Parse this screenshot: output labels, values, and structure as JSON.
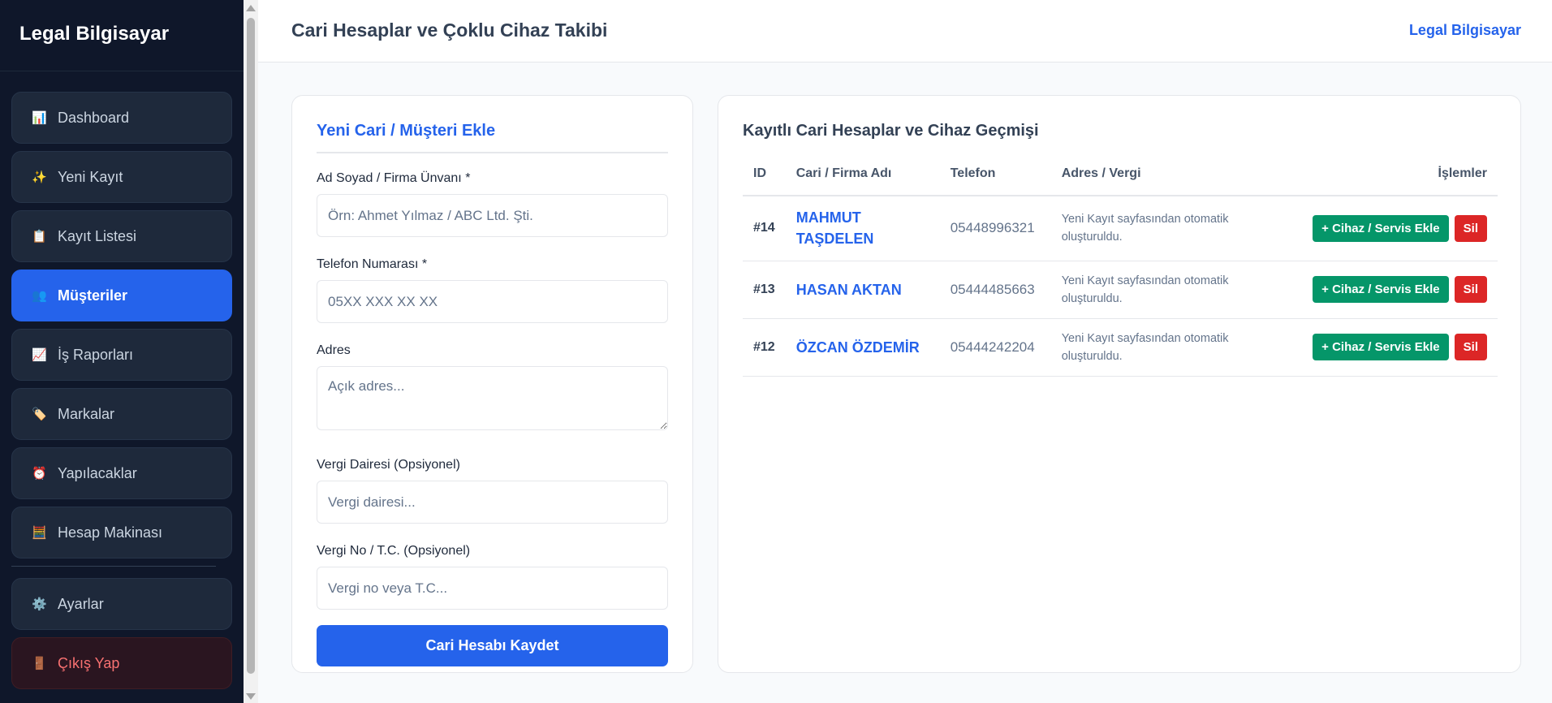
{
  "sidebar": {
    "brand": "Legal Bilgisayar",
    "items": [
      {
        "icon": "📊",
        "label": "Dashboard"
      },
      {
        "icon": "✨",
        "label": "Yeni Kayıt"
      },
      {
        "icon": "📋",
        "label": "Kayıt Listesi"
      },
      {
        "icon": "👥",
        "label": "Müşteriler"
      },
      {
        "icon": "📈",
        "label": "İş Raporları"
      },
      {
        "icon": "🏷️",
        "label": "Markalar"
      },
      {
        "icon": "⏰",
        "label": "Yapılacaklar"
      },
      {
        "icon": "🧮",
        "label": "Hesap Makinası"
      },
      {
        "icon": "⚙️",
        "label": "Ayarlar"
      },
      {
        "icon": "🚪",
        "label": "Çıkış Yap"
      }
    ],
    "active_index": 3
  },
  "header": {
    "title": "Cari Hesaplar ve Çoklu Cihaz Takibi",
    "link": "Legal Bilgisayar"
  },
  "form": {
    "title": "Yeni Cari / Müşteri Ekle",
    "name_label": "Ad Soyad / Firma Ünvanı *",
    "name_placeholder": "Örn: Ahmet Yılmaz / ABC Ltd. Şti.",
    "phone_label": "Telefon Numarası *",
    "phone_placeholder": "05XX XXX XX XX",
    "address_label": "Adres",
    "address_placeholder": "Açık adres...",
    "tax_office_label": "Vergi Dairesi (Opsiyonel)",
    "tax_office_placeholder": "Vergi dairesi...",
    "tax_no_label": "Vergi No / T.C. (Opsiyonel)",
    "tax_no_placeholder": "Vergi no veya T.C...",
    "save_label": "Cari Hesabı Kaydet"
  },
  "list": {
    "title": "Kayıtlı Cari Hesaplar ve Cihaz Geçmişi",
    "columns": [
      "ID",
      "Cari / Firma Adı",
      "Telefon",
      "Adres / Vergi",
      "İşlemler"
    ],
    "add_label": "+ Cihaz / Servis Ekle",
    "delete_label": "Sil",
    "rows": [
      {
        "id": "#14",
        "name": "MAHMUT TAŞDELEN",
        "phone": "05448996321",
        "address": "Yeni Kayıt sayfasından otomatik oluşturuldu."
      },
      {
        "id": "#13",
        "name": "HASAN AKTAN",
        "phone": "05444485663",
        "address": "Yeni Kayıt sayfasından otomatik oluşturuldu."
      },
      {
        "id": "#12",
        "name": "ÖZCAN ÖZDEMİR",
        "phone": "05444242204",
        "address": "Yeni Kayıt sayfasından otomatik oluşturuldu."
      }
    ]
  },
  "colors": {
    "sidebar_bg": "#0f172a",
    "accent": "#2563eb",
    "success": "#059669",
    "danger": "#dc2626"
  }
}
